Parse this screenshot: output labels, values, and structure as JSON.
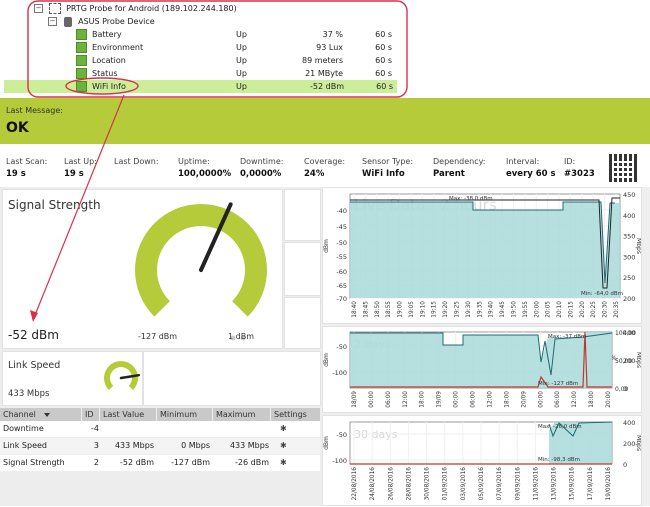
{
  "tree": {
    "probe": "PRTG Probe for Android (189.102.244.180)",
    "device": "ASUS Probe Device",
    "sensors": [
      {
        "name": "Battery",
        "status": "Up",
        "value": "37 %",
        "interval": "60 s"
      },
      {
        "name": "Environment",
        "status": "Up",
        "value": "93 Lux",
        "interval": "60 s"
      },
      {
        "name": "Location",
        "status": "Up",
        "value": "89 meters",
        "interval": "60 s"
      },
      {
        "name": "Status",
        "status": "Up",
        "value": "21 MByte",
        "interval": "60 s"
      },
      {
        "name": "WiFi Info",
        "status": "Up",
        "value": "-52 dBm",
        "interval": "60 s"
      }
    ]
  },
  "message": {
    "label": "Last Message:",
    "text": "OK"
  },
  "stats": [
    {
      "label": "Last Scan:",
      "value": "19 s"
    },
    {
      "label": "Last Up:",
      "value": "19 s"
    },
    {
      "label": "Last Down:",
      "value": ""
    },
    {
      "label": "Uptime:",
      "value": "100,0000%"
    },
    {
      "label": "Downtime:",
      "value": "0,0000%"
    },
    {
      "label": "Coverage:",
      "value": "24%"
    },
    {
      "label": "Sensor Type:",
      "value": "WiFi Info"
    },
    {
      "label": "Dependency:",
      "value": "Parent"
    },
    {
      "label": "Interval:",
      "value": "every 60 s"
    },
    {
      "label": "ID:",
      "value": "#3023"
    }
  ],
  "gauge_main": {
    "title": "Signal Strength",
    "value_label": "-52 dBm",
    "min_label": "-127 dBm",
    "max_label": "1 dBm",
    "fraction": 0.59
  },
  "gauge_small": {
    "title": "Link Speed",
    "value_label": "433 Mbps",
    "fraction": 0.8
  },
  "channels": {
    "headers": [
      "Channel",
      "ID",
      "Last Value",
      "Minimum",
      "Maximum",
      "Settings"
    ],
    "rows": [
      {
        "channel": "Downtime",
        "id": "-4",
        "last": "",
        "min": "",
        "max": ""
      },
      {
        "channel": "Link Speed",
        "id": "3",
        "last": "433 Mbps",
        "min": "0 Mbps",
        "max": "433 Mbps"
      },
      {
        "channel": "Signal Strength",
        "id": "2",
        "last": "-52 dBm",
        "min": "-127 dBm",
        "max": "-26 dBm"
      }
    ]
  },
  "graph1": {
    "title": "Live Data - 2 hours",
    "ylabel": "dBm",
    "y2label": "Mbps",
    "yticks": [
      "-40",
      "-45",
      "-50",
      "-55",
      "-60",
      "-65",
      "-70"
    ],
    "y2ticks": [
      "450",
      "400",
      "350",
      "300",
      "250",
      "200"
    ],
    "xticks": [
      "18:40",
      "18:45",
      "18:50",
      "18:55",
      "19:00",
      "19:05",
      "19:10",
      "19:15",
      "19:20",
      "19:25",
      "19:30",
      "19:35",
      "19:40",
      "19:45",
      "19:50",
      "19:55",
      "20:00",
      "20:05",
      "20:10",
      "20:15",
      "20:20",
      "20:25",
      "20:30",
      "20:35"
    ],
    "max_label": "Max: -38,0 dBm",
    "min_label": "Min: -64,0 dBm"
  },
  "graph2": {
    "title": "2 days",
    "ylabel": "dBm",
    "y2label": "Mbps",
    "y2unit": "%",
    "yticks": [
      "-50",
      "-100"
    ],
    "y2ticks": [
      "400",
      "200",
      "0"
    ],
    "pticks": [
      "100,00",
      "50,00",
      "0,00"
    ],
    "xticks": [
      "18/09",
      "00:00",
      "06:00",
      "12:00",
      "18:00",
      "19/09",
      "00:00",
      "06:00",
      "12:00",
      "18:00",
      "20/09",
      "00:00",
      "06:00",
      "12:00",
      "18:00",
      "20:00"
    ],
    "max_label": "Max: -37 dBm",
    "min_label": "Min: -127 dBm"
  },
  "graph3": {
    "title": "30 days",
    "ylabel": "dBm",
    "y2label": "Mbps",
    "yticks": [
      "-50",
      "-100"
    ],
    "y2ticks": [
      "400",
      "200",
      "0"
    ],
    "xticks": [
      "22/08/2016",
      "24/08/2016",
      "26/08/2016",
      "28/08/2016",
      "30/08/2016",
      "01/09/2016",
      "03/09/2016",
      "05/09/2016",
      "07/09/2016",
      "09/09/2016",
      "11/09/2016",
      "13/09/2016",
      "15/09/2016",
      "17/09/2016",
      "19/09/2016"
    ],
    "max_label": "Max: -26,0 dBm",
    "min_label": "Min: -98,3 dBm"
  },
  "colors": {
    "accent": "#b5cb3a",
    "check": "#6cb33e",
    "annotation": "#d9304a",
    "graph_fill": "#a9d9d9"
  }
}
